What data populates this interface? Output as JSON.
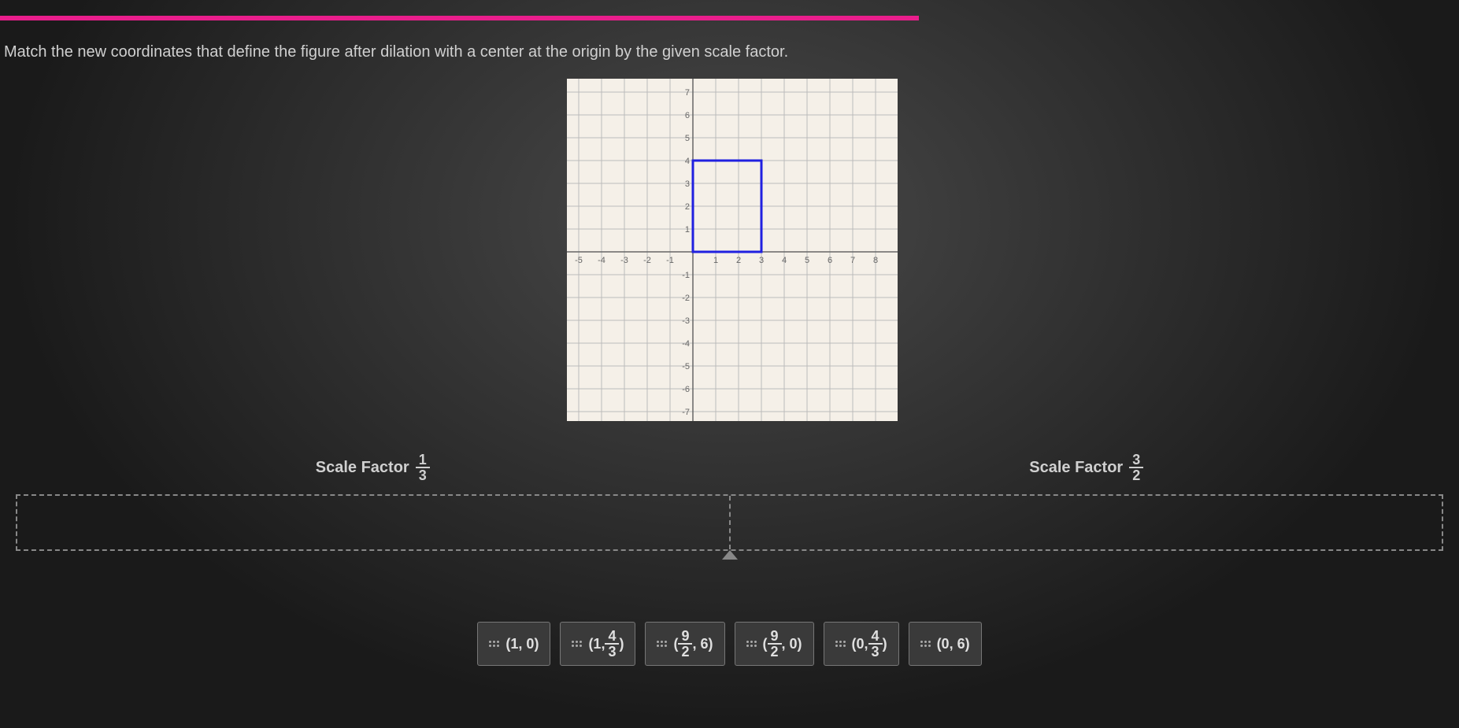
{
  "question": "Match the new coordinates that define the figure after dilation with a center at the origin by the given scale factor.",
  "graph": {
    "x_ticks": [
      "-5",
      "-4",
      "-3",
      "-2",
      "-1",
      "1",
      "2",
      "3",
      "4",
      "5",
      "6",
      "7",
      "8"
    ],
    "y_ticks_pos": [
      "1",
      "2",
      "3",
      "4",
      "5",
      "6",
      "7"
    ],
    "y_ticks_neg": [
      "-1",
      "-2",
      "-3",
      "-4",
      "-5",
      "-6",
      "-7"
    ],
    "rectangle": {
      "x1": 0,
      "y1": 0,
      "x2": 3,
      "y2": 4
    }
  },
  "scale_factors": {
    "left": {
      "label": "Scale Factor",
      "num": "1",
      "den": "3"
    },
    "right": {
      "label": "Scale Factor",
      "num": "3",
      "den": "2"
    }
  },
  "options": [
    {
      "type": "plain",
      "text": "(1, 0)"
    },
    {
      "type": "frac_second",
      "open": "(1, ",
      "num": "4",
      "den": "3",
      "close": ")"
    },
    {
      "type": "frac_first",
      "open": "(",
      "num": "9",
      "den": "2",
      "mid": ", 6)",
      "close": ""
    },
    {
      "type": "frac_first",
      "open": "(",
      "num": "9",
      "den": "2",
      "mid": ", 0)",
      "close": ""
    },
    {
      "type": "frac_second",
      "open": "(0, ",
      "num": "4",
      "den": "3",
      "close": ")"
    },
    {
      "type": "plain",
      "text": "(0, 6)"
    }
  ]
}
